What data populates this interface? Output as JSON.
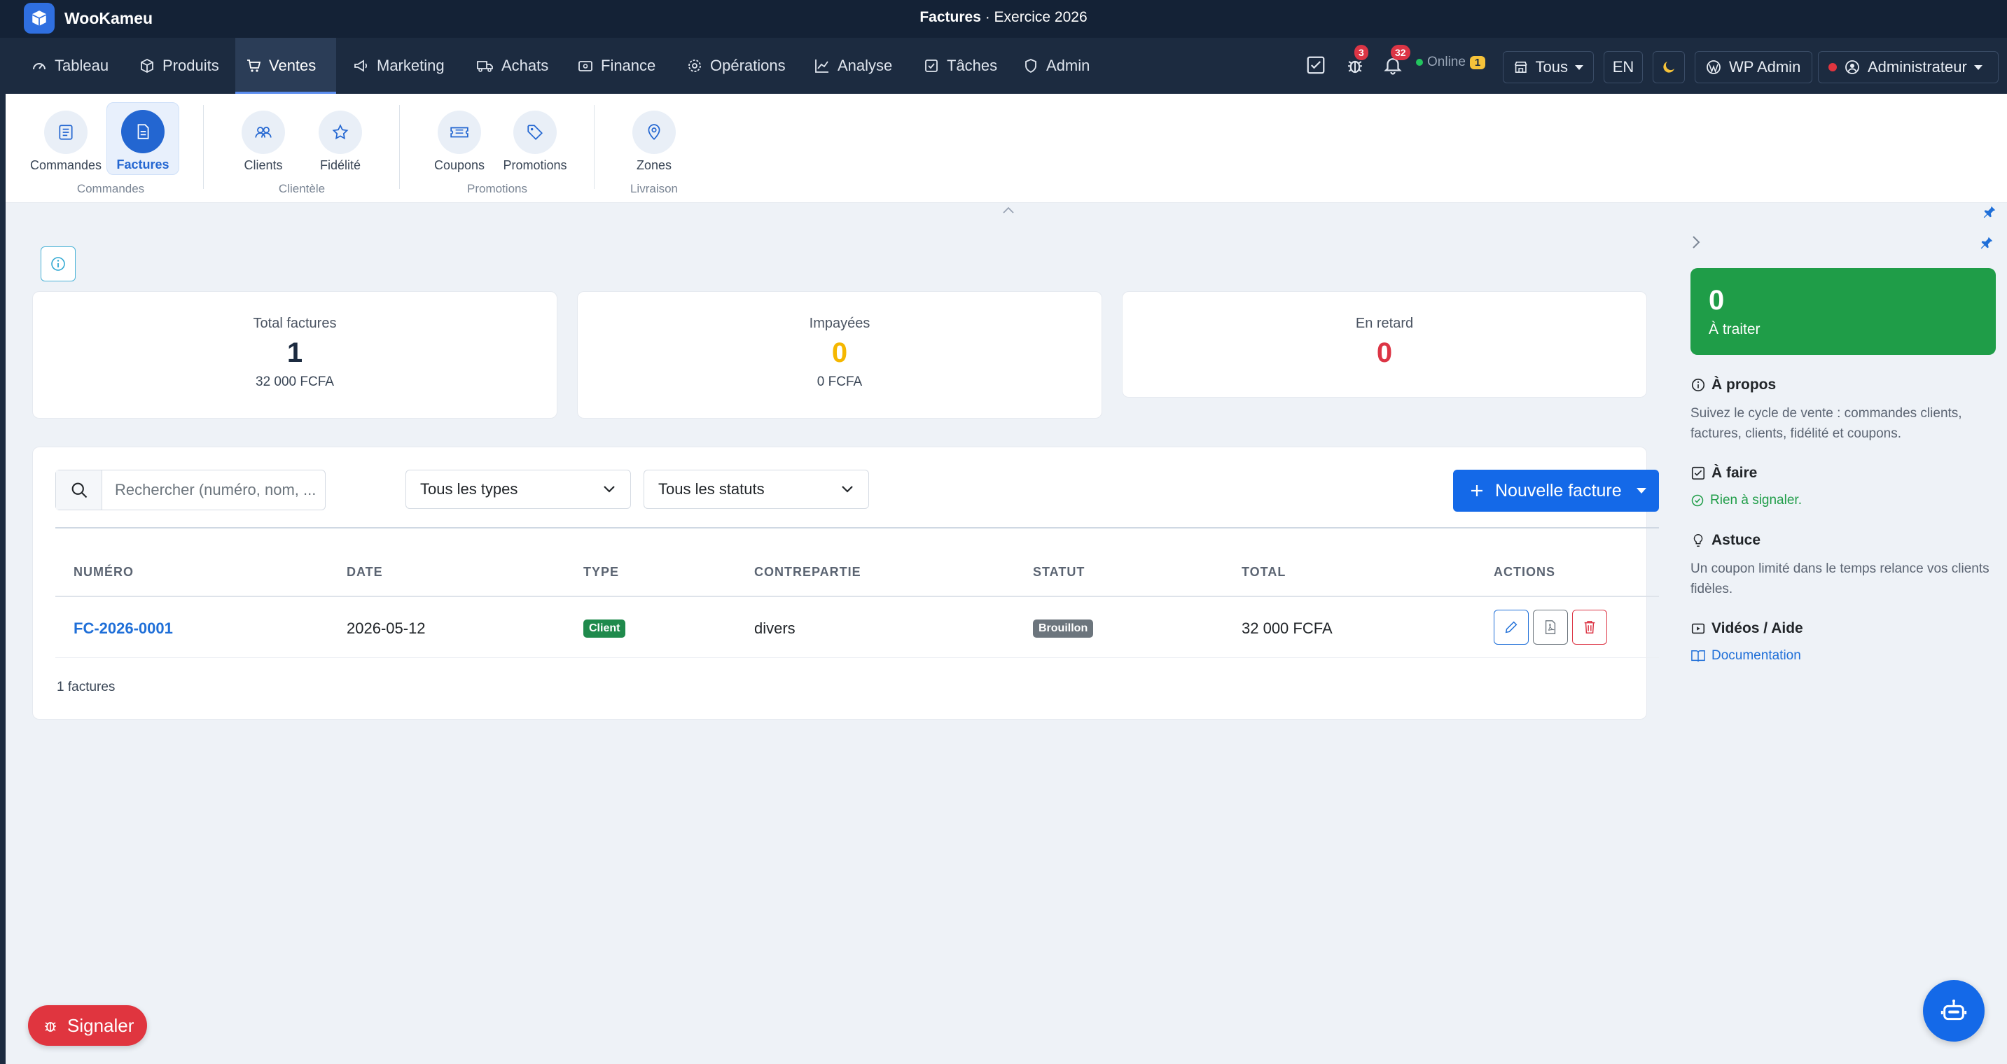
{
  "app": {
    "brand": "WooKameu",
    "window_title_bold": "Factures",
    "window_title_rest": " · Exercice 2026"
  },
  "nav": {
    "items": [
      {
        "label": "Tableau",
        "icon": "gauge-icon"
      },
      {
        "label": "Produits",
        "icon": "box-icon"
      },
      {
        "label": "Ventes",
        "icon": "cart-icon",
        "active": true
      },
      {
        "label": "Marketing",
        "icon": "megaphone-icon"
      },
      {
        "label": "Achats",
        "icon": "truck-icon"
      },
      {
        "label": "Finance",
        "icon": "wallet-icon"
      },
      {
        "label": "Opérations",
        "icon": "gear-icon"
      },
      {
        "label": "Analyse",
        "icon": "chart-line-icon"
      },
      {
        "label": "Tâches",
        "icon": "checklist-icon"
      },
      {
        "label": "Admin",
        "icon": "shield-icon"
      }
    ],
    "bug_count": "3",
    "notif_count": "32",
    "online_label": "Online",
    "online_count": "1",
    "store_label": "Tous",
    "lang": "EN",
    "wp_admin": "WP Admin",
    "user": "Administrateur"
  },
  "ribbon": {
    "items": [
      {
        "label": "Commandes",
        "icon": "list-icon"
      },
      {
        "label": "Factures",
        "icon": "invoice-icon",
        "active": true
      },
      {
        "label": "Clients",
        "icon": "users-icon"
      },
      {
        "label": "Fidélité",
        "icon": "star-icon"
      },
      {
        "label": "Coupons",
        "icon": "ticket-icon"
      },
      {
        "label": "Promotions",
        "icon": "tag-icon"
      },
      {
        "label": "Zones",
        "icon": "location-pin-icon"
      }
    ],
    "groups": [
      "Commandes",
      "Clientèle",
      "Promotions",
      "Livraison"
    ]
  },
  "stats": [
    {
      "title": "Total factures",
      "value": "1",
      "sub": "32 000 FCFA",
      "color": "#1c2b40"
    },
    {
      "title": "Impayées",
      "value": "0",
      "sub": "0 FCFA",
      "color": "#f5b700"
    },
    {
      "title": "En retard",
      "value": "0",
      "sub": "",
      "color": "#dc3545"
    }
  ],
  "filters": {
    "search_placeholder": "Rechercher (numéro, nom, ...",
    "type_select": "Tous les types",
    "status_select": "Tous les statuts",
    "new_button": "Nouvelle facture"
  },
  "table": {
    "headers": [
      "NUMÉRO",
      "DATE",
      "TYPE",
      "CONTREPARTIE",
      "STATUT",
      "TOTAL",
      "ACTIONS"
    ],
    "rows": [
      {
        "numero": "FC-2026-0001",
        "date": "2026-05-12",
        "type": "Client",
        "contrepartie": "divers",
        "statut": "Brouillon",
        "total": "32 000 FCFA"
      }
    ],
    "count_label": "1 factures"
  },
  "side": {
    "todo_count": "0",
    "todo_label": "À traiter",
    "about_title": "À propos",
    "about_text": "Suivez le cycle de vente : commandes clients, factures, clients, fidélité et coupons.",
    "afaire_title": "À faire",
    "afaire_text": "Rien à signaler.",
    "tip_title": "Astuce",
    "tip_text": "Un coupon limité dans le temps relance vos clients fidèles.",
    "videos_title": "Vidéos / Aide",
    "doc_link": "Documentation"
  },
  "report_button": "Signaler",
  "colors": {
    "primary": "#1469e8",
    "nav_bg": "#1c2b40",
    "success": "#1f9d48",
    "danger": "#dc3545",
    "warning": "#f5b700"
  }
}
